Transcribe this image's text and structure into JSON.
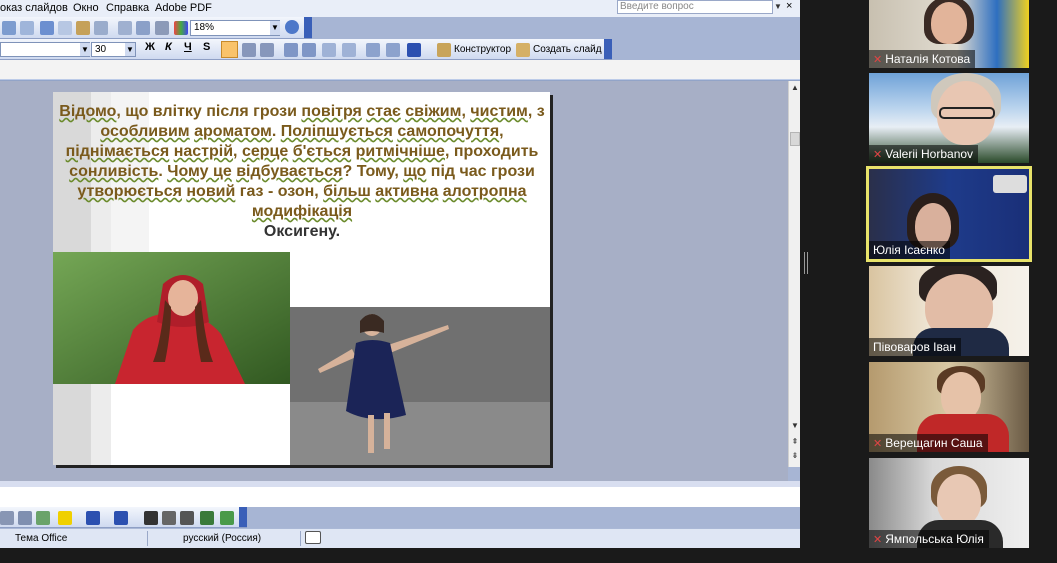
{
  "menubar": {
    "items": [
      "оказ слайдов",
      "Окно",
      "Справка",
      "Adobe PDF"
    ],
    "ask_placeholder": "Введите вопрос",
    "close_glyph": "×"
  },
  "toolbar1": {
    "zoom": "18%"
  },
  "toolbar2": {
    "font_size": "30",
    "bold": "Ж",
    "italic": "К",
    "underline": "Ч",
    "shadow": "S",
    "designer_label": "Конструктор",
    "new_slide_label": "Создать слайд"
  },
  "slide": {
    "segments": [
      {
        "t": "Відомо",
        "u": true
      },
      {
        "t": ", що влітку після грози ",
        "u": false
      },
      {
        "t": "повітря",
        "u": true
      },
      {
        "t": " ",
        "u": false
      },
      {
        "t": "стає",
        "u": true
      },
      {
        "t": " ",
        "u": false
      },
      {
        "t": "свіжим",
        "u": true
      },
      {
        "t": ", ",
        "u": false
      },
      {
        "t": "чистим",
        "u": true
      },
      {
        "t": ", з ",
        "u": false
      },
      {
        "t": "особливим",
        "u": true
      },
      {
        "t": " ",
        "u": false
      },
      {
        "t": "ароматом",
        "u": true
      },
      {
        "t": ". ",
        "u": false
      },
      {
        "t": "Поліпшується",
        "u": true
      },
      {
        "t": " ",
        "u": false
      },
      {
        "t": "самопочуття",
        "u": true
      },
      {
        "t": ", ",
        "u": false
      },
      {
        "t": "піднімається",
        "u": true
      },
      {
        "t": " ",
        "u": false
      },
      {
        "t": "настрій",
        "u": true
      },
      {
        "t": ", ",
        "u": false
      },
      {
        "t": "серце",
        "u": true
      },
      {
        "t": " ",
        "u": false
      },
      {
        "t": "б'ється",
        "u": true
      },
      {
        "t": " ",
        "u": false
      },
      {
        "t": "ритмічніше",
        "u": true
      },
      {
        "t": ", проходить ",
        "u": false
      },
      {
        "t": "сонливість",
        "u": true
      },
      {
        "t": ". ",
        "u": false
      },
      {
        "t": "Чому це",
        "u": true
      },
      {
        "t": " ",
        "u": false
      },
      {
        "t": "відбувається",
        "u": true
      },
      {
        "t": "? Тому, ",
        "u": false
      },
      {
        "t": "що",
        "u": true
      },
      {
        "t": " під час грози ",
        "u": false
      },
      {
        "t": "утворюється",
        "u": true
      },
      {
        "t": " ",
        "u": false
      },
      {
        "t": "новий",
        "u": true
      },
      {
        "t": " ",
        "u": false
      },
      {
        "t": "газ - озон, ",
        "u": false
      },
      {
        "t": "більш",
        "u": true
      },
      {
        "t": " ",
        "u": false
      },
      {
        "t": "активна",
        "u": true
      },
      {
        "t": " ",
        "u": false
      },
      {
        "t": "алотропна",
        "u": true
      },
      {
        "t": " ",
        "u": false
      },
      {
        "t": "модифікація",
        "u": true
      }
    ],
    "last_line": "Оксигену."
  },
  "status": {
    "theme": "Тема Office",
    "language": "русский (Россия)"
  },
  "participants": [
    {
      "name": "Наталія Котова",
      "muted": true
    },
    {
      "name": "Valerii Horbanov",
      "muted": true
    },
    {
      "name": "Юлія Ісаєнко",
      "muted": false,
      "active": true
    },
    {
      "name": "Півоваров Іван",
      "muted": false
    },
    {
      "name": "Верещагин Саша",
      "muted": true
    },
    {
      "name": "Ямпольська Юлія",
      "muted": true
    }
  ],
  "colors": {
    "slide_text": "#7a5a1c",
    "active_speaker_border": "#e8e36a",
    "muted_icon": "#e04545"
  }
}
